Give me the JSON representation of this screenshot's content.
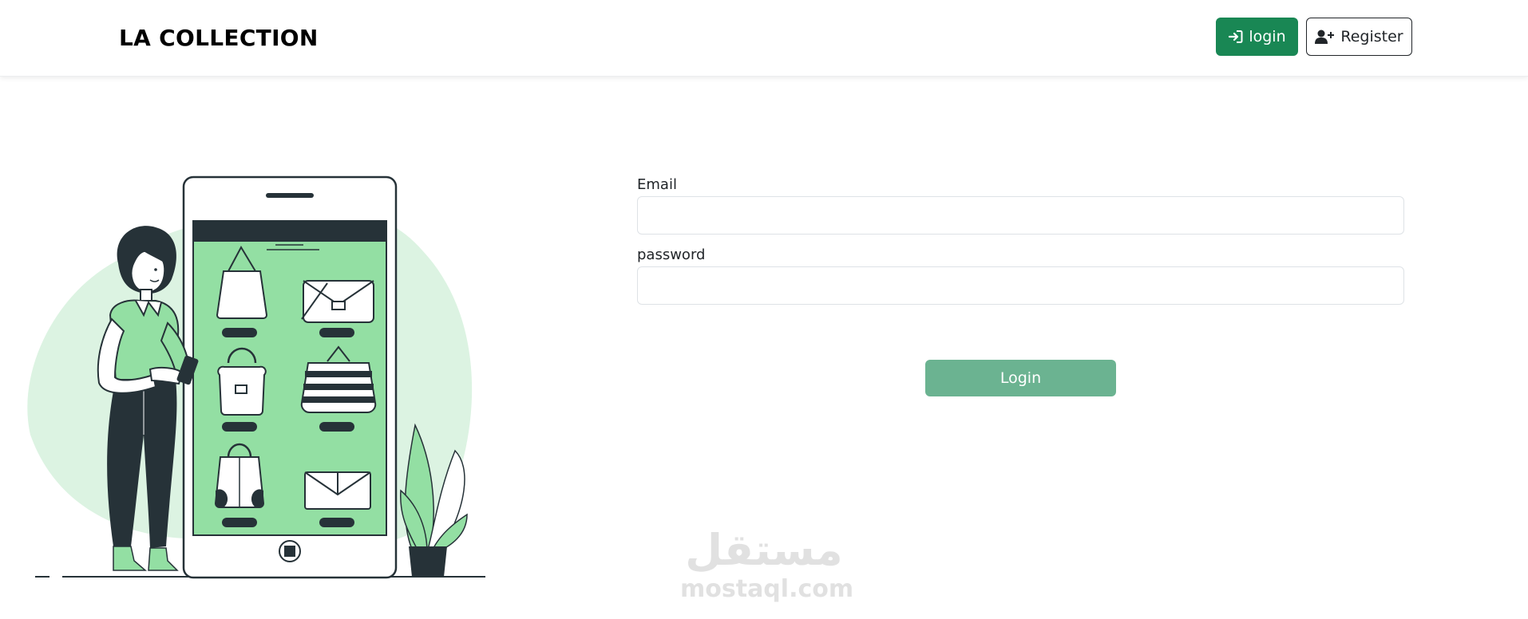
{
  "navbar": {
    "brand": "LA COLLECTION",
    "login_button": {
      "label": "login",
      "icon": "sign-in-icon"
    },
    "register_button": {
      "label": "Register",
      "icon": "user-plus-icon"
    }
  },
  "form": {
    "email_label": "Email",
    "email_value": "",
    "password_label": "password",
    "password_value": "",
    "submit_label": "Login"
  },
  "watermark": {
    "arabic": "مستقل",
    "latin": "mostaql.com"
  },
  "colors": {
    "accent": "#198754",
    "submit": "#6bb391",
    "illustration_light": "#dcf3e2",
    "illustration_mid": "#93dfa3",
    "illustration_dark": "#263238"
  }
}
